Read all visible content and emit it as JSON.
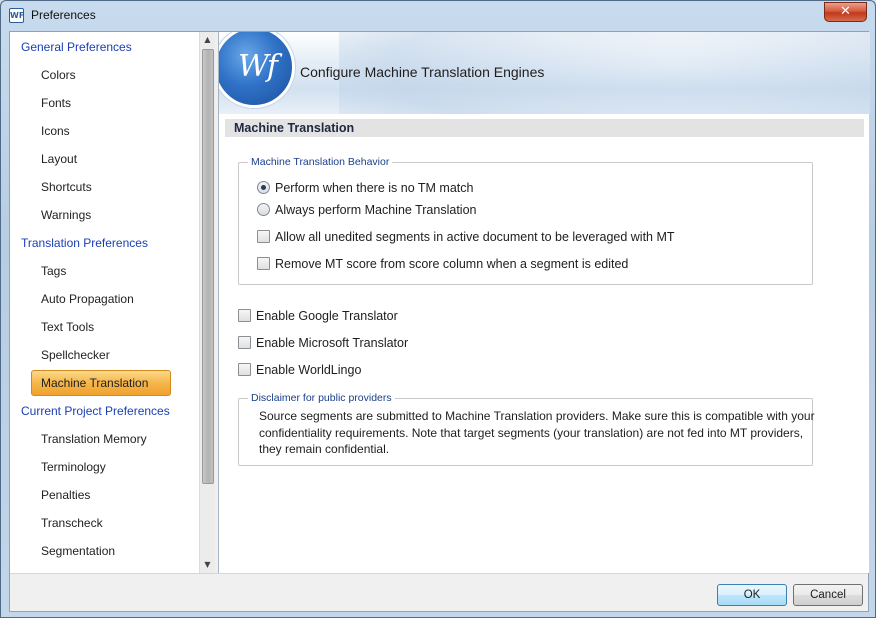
{
  "window": {
    "title": "Preferences",
    "app_icon_text": "WF",
    "close_glyph": "✕"
  },
  "sidebar": {
    "items": [
      {
        "label": "General Preferences",
        "type": "section"
      },
      {
        "label": "Colors",
        "type": "item"
      },
      {
        "label": "Fonts",
        "type": "item"
      },
      {
        "label": "Icons",
        "type": "item"
      },
      {
        "label": "Layout",
        "type": "item"
      },
      {
        "label": "Shortcuts",
        "type": "item"
      },
      {
        "label": "Warnings",
        "type": "item"
      },
      {
        "label": "Translation Preferences",
        "type": "section"
      },
      {
        "label": "Tags",
        "type": "item"
      },
      {
        "label": "Auto Propagation",
        "type": "item"
      },
      {
        "label": "Text Tools",
        "type": "item"
      },
      {
        "label": "Spellchecker",
        "type": "item"
      },
      {
        "label": "Machine Translation",
        "type": "item",
        "selected": true
      },
      {
        "label": "Current Project Preferences",
        "type": "section"
      },
      {
        "label": "Translation Memory",
        "type": "item"
      },
      {
        "label": "Terminology",
        "type": "item"
      },
      {
        "label": "Penalties",
        "type": "item"
      },
      {
        "label": "Transcheck",
        "type": "item"
      },
      {
        "label": "Segmentation",
        "type": "item"
      }
    ]
  },
  "banner": {
    "logo_text": "Wf",
    "title": "Configure Machine Translation Engines"
  },
  "section_header": "Machine Translation",
  "behavior": {
    "legend": "Machine Translation Behavior",
    "radio_no_tm": "Perform when there is no TM match",
    "radio_always": "Always perform Machine Translation",
    "selected": "no_tm",
    "check_unedited": "Allow all unedited segments in active document to be leveraged with MT",
    "check_remove_score": "Remove MT score from score column when a segment is edited"
  },
  "engines": {
    "google": "Enable Google Translator",
    "microsoft": "Enable Microsoft Translator",
    "worldlingo": "Enable WorldLingo"
  },
  "disclaimer": {
    "legend": "Disclaimer for public providers",
    "text": "Source segments are submitted to Machine Translation providers. Make sure this is compatible with your confidentiality requirements. Note that target segments (your translation) are not fed into MT providers, they remain confidential."
  },
  "footer": {
    "ok": "OK",
    "cancel": "Cancel"
  },
  "colors": {
    "section_link": "#1a3fb4",
    "selected_item": "#f6b54a",
    "close_button": "#c0391a"
  }
}
